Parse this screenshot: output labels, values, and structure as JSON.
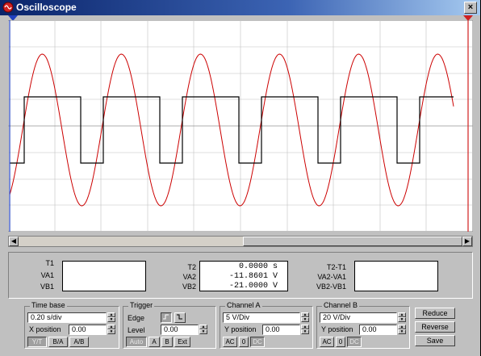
{
  "window": {
    "title": "Oscilloscope",
    "close": "×"
  },
  "markers": {
    "t1": "1",
    "t2": "2"
  },
  "scope": {
    "trace_colors": {
      "channel_a": "#000000",
      "channel_b": "#cc0000"
    },
    "grid_color": "#c0c0c0",
    "background": "#ffffff"
  },
  "readout": {
    "t1": {
      "label": "T1",
      "va1": "VA1",
      "vb1": "VB1"
    },
    "t2": {
      "label": "T2",
      "va2": "VA2",
      "vb2": "VB2",
      "t_value": "0.0000",
      "t_unit": "s",
      "va_value": "-11.8601",
      "va_unit": "V",
      "vb_value": "-21.0000",
      "vb_unit": "V"
    },
    "diff": {
      "label": "T2-T1",
      "va": "VA2-VA1",
      "vb": "VB2-VB1"
    }
  },
  "timebase": {
    "title": "Time base",
    "value": "0.20 s/div",
    "xpos_label": "X position",
    "xpos_value": "0.00",
    "modes": [
      "Y/T",
      "B/A",
      "A/B"
    ]
  },
  "trigger": {
    "title": "Trigger",
    "edge_label": "Edge",
    "level_label": "Level",
    "level_value": "0.00",
    "modes": [
      "Auto",
      "A",
      "B",
      "Ext"
    ]
  },
  "channel_a": {
    "title": "Channel A",
    "value": "5  V/Div",
    "ypos_label": "Y position",
    "ypos_value": "0.00",
    "coupling": [
      "AC",
      "0",
      "DC"
    ]
  },
  "channel_b": {
    "title": "Channel B",
    "value": "20  V/Div",
    "ypos_label": "Y position",
    "ypos_value": "0.00",
    "coupling": [
      "AC",
      "0",
      "DC"
    ]
  },
  "actions": {
    "reduce": "Reduce",
    "reverse": "Reverse",
    "save": "Save"
  }
}
